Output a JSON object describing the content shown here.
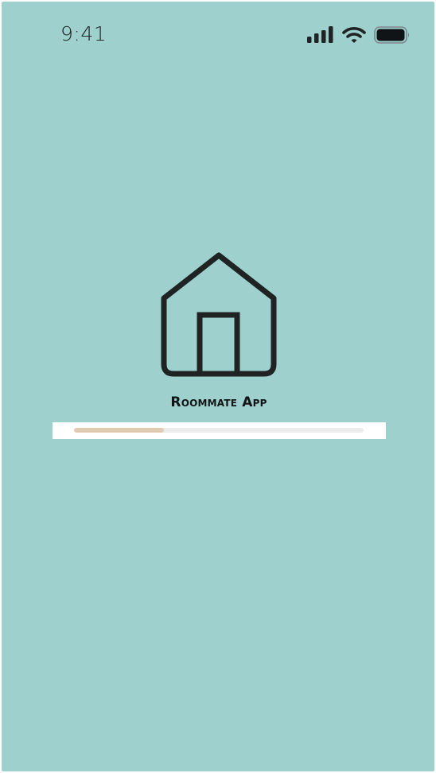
{
  "theme": {
    "background": "#9ed1ce",
    "progress_fill": "#e2cbb3",
    "progress_track": "#ececec",
    "icon_color": "#1f2324"
  },
  "status_bar": {
    "time": "9:41",
    "icons": [
      "cellular-signal-icon",
      "wifi-icon",
      "battery-icon"
    ]
  },
  "splash": {
    "logo_icon": "house-icon",
    "title": "Roommate App"
  },
  "loading": {
    "progress_fraction": 0.31
  }
}
